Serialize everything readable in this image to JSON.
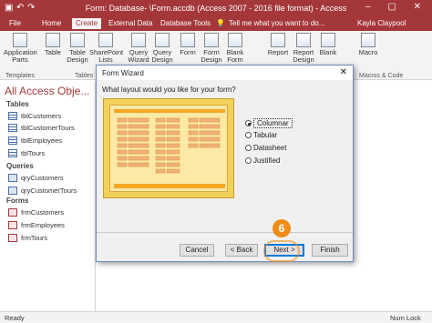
{
  "window": {
    "title": "Form: Database- \\Form.accdb (Access 2007 - 2016 file format) - Access",
    "user": "Kayla Claypool",
    "controls": "– ▢ ✕"
  },
  "menu": {
    "tabs": [
      "File",
      "Home",
      "Create",
      "External Data",
      "Database Tools"
    ],
    "tell_me": "Tell me what you want to do..."
  },
  "ribbon": {
    "buttons": [
      "Application Parts",
      "Table",
      "Table Design",
      "SharePoint Lists",
      "Query Wizard",
      "Query Design",
      "Form",
      "Form Design",
      "Blank Form",
      "Report",
      "Report Design",
      "Blank",
      "Macro"
    ],
    "groups": [
      "Templates",
      "Tables",
      "Macros & Code"
    ]
  },
  "nav": {
    "title": "All Access Obje...",
    "sections": [
      {
        "label": "Tables",
        "items": [
          "tblCustomers",
          "tblCustomerTours",
          "tblEmployees",
          "tblTours"
        ]
      },
      {
        "label": "Queries",
        "items": [
          "qryCustomers",
          "qryCustomerTours"
        ]
      },
      {
        "label": "Forms",
        "items": [
          "frmCustomers",
          "frmEmployees",
          "frmTours"
        ]
      }
    ]
  },
  "dialog": {
    "title": "Form Wizard",
    "close": "✕",
    "question": "What layout would you like for your form?",
    "options": [
      "Columnar",
      "Tabular",
      "Datasheet",
      "Justified"
    ],
    "selected": "Columnar",
    "buttons": {
      "cancel": "Cancel",
      "back": "< Back",
      "next": "Next >",
      "finish": "Finish"
    }
  },
  "step_badge": "6",
  "status": {
    "left": "Ready",
    "right": "Num Lock"
  },
  "colors": {
    "access_red": "#a4373a",
    "step_orange": "#f08c1a",
    "preview_gold": "#f2d15a"
  }
}
